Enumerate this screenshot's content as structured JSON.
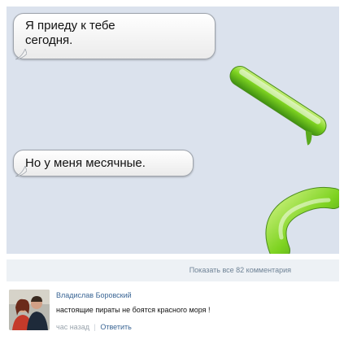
{
  "messages": [
    {
      "text": "Я приеду к тебе\nсегодня."
    },
    {
      "text": "Но у меня месячные."
    }
  ],
  "comments_link": "Показать все 82 комментария",
  "comment": {
    "author": "Владислав Боровский",
    "text": "настоящие пираты не боятся красного моря !",
    "time": "час назад",
    "separator": "|",
    "reply": "Ответить"
  },
  "colors": {
    "chat_background": "#dbe2ed",
    "green_bubble": "#7ed321",
    "link": "#3b6695"
  },
  "icons": [
    "green-pill-bubble",
    "curved-green-bubble"
  ]
}
